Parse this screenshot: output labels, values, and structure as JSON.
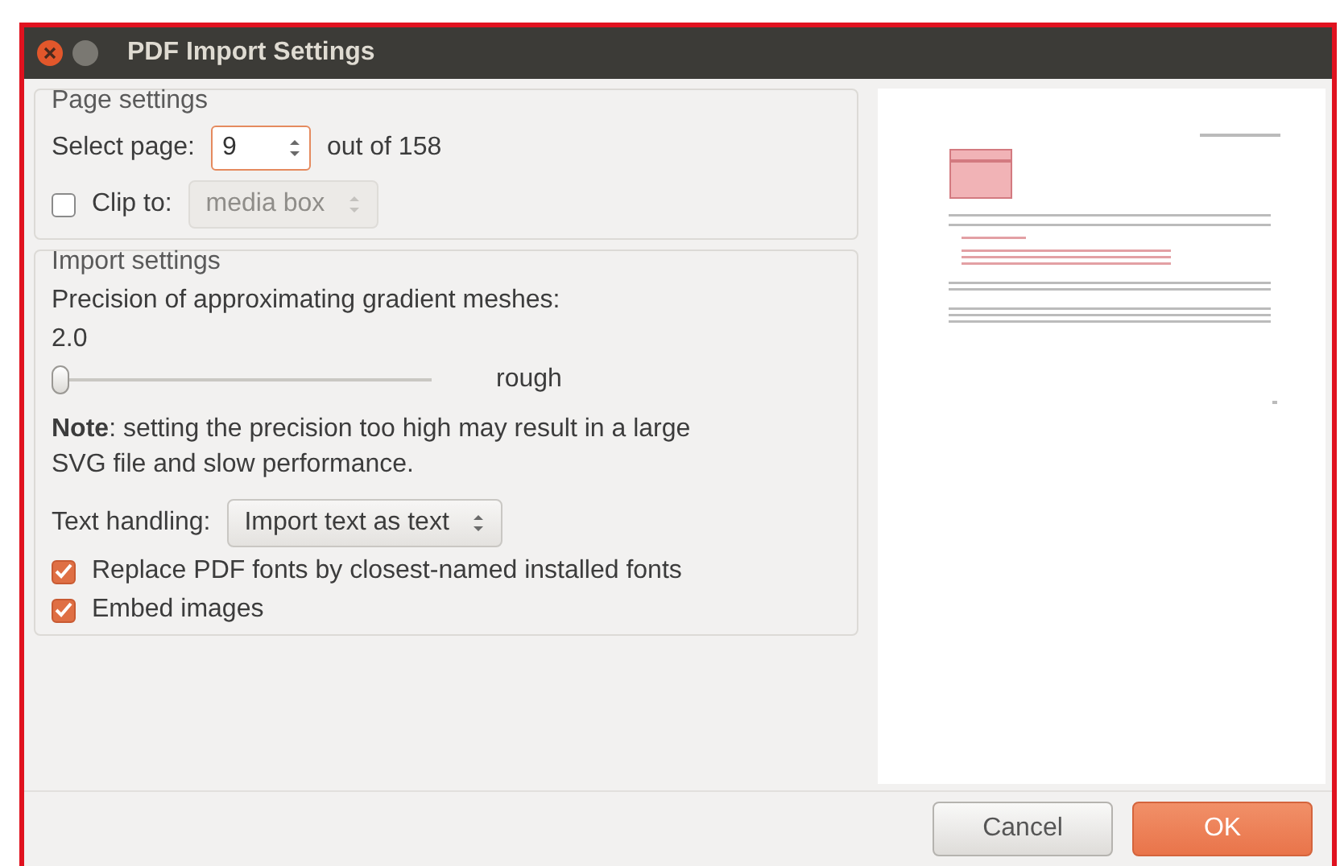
{
  "window": {
    "title": "PDF Import Settings"
  },
  "page_settings": {
    "title": "Page settings",
    "select_page_label": "Select page:",
    "page_value": "9",
    "page_count": "out of 158",
    "clip": {
      "label": "Clip to:",
      "checked": false,
      "value": "media box",
      "disabled": true
    }
  },
  "import_settings": {
    "title": "Import settings",
    "precision_label": "Precision of approximating gradient meshes:",
    "precision_value": "2.0",
    "slider": {
      "level": 0.0
    },
    "slider_label": "rough",
    "note": "**Note**: setting the precision too high may result in a large SVG file and slow performance.",
    "text_handling": {
      "label": "Text handling:",
      "value": "Import text as text"
    },
    "options": [
      {
        "label": "Replace PDF fonts by closest-named installed fonts",
        "checked": true
      },
      {
        "label": "Embed images",
        "checked": true
      }
    ]
  },
  "buttons": [
    {
      "label": "Cancel",
      "kind": "secondary"
    },
    {
      "label": "OK",
      "kind": "primary"
    }
  ]
}
